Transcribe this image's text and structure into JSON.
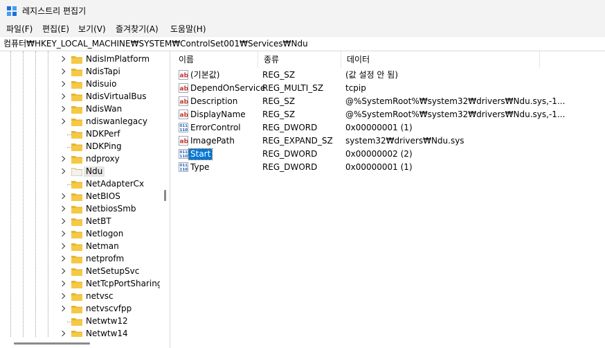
{
  "window": {
    "title": "레지스트리 편집기"
  },
  "menu": [
    "파일(F)",
    "편집(E)",
    "보기(V)",
    "즐겨찾기(A)",
    "도움말(H)"
  ],
  "address": "컴퓨터₩HKEY_LOCAL_MACHINE₩SYSTEM₩ControlSet001₩Services₩Ndu",
  "tree": {
    "items": [
      {
        "label": "NdisImPlatform",
        "expandable": true
      },
      {
        "label": "NdisTapi",
        "expandable": true
      },
      {
        "label": "Ndisuio",
        "expandable": true
      },
      {
        "label": "NdisVirtualBus",
        "expandable": true
      },
      {
        "label": "NdisWan",
        "expandable": true
      },
      {
        "label": "ndiswanlegacy",
        "expandable": true
      },
      {
        "label": "NDKPerf",
        "expandable": false
      },
      {
        "label": "NDKPing",
        "expandable": false
      },
      {
        "label": "ndproxy",
        "expandable": true
      },
      {
        "label": "Ndu",
        "expandable": true,
        "selected": true
      },
      {
        "label": "NetAdapterCx",
        "expandable": false
      },
      {
        "label": "NetBIOS",
        "expandable": true
      },
      {
        "label": "NetbiosSmb",
        "expandable": true
      },
      {
        "label": "NetBT",
        "expandable": true
      },
      {
        "label": "Netlogon",
        "expandable": true
      },
      {
        "label": "Netman",
        "expandable": true
      },
      {
        "label": "netprofm",
        "expandable": true
      },
      {
        "label": "NetSetupSvc",
        "expandable": true
      },
      {
        "label": "NetTcpPortSharing",
        "expandable": true
      },
      {
        "label": "netvsc",
        "expandable": true
      },
      {
        "label": "netvscvfpp",
        "expandable": true
      },
      {
        "label": "Netwtw12",
        "expandable": false
      },
      {
        "label": "Netwtw14",
        "expandable": true
      }
    ]
  },
  "list": {
    "columns": [
      "이름",
      "종류",
      "데이터"
    ],
    "rows": [
      {
        "name": "(기본값)",
        "type": "REG_SZ",
        "data": "(값 설정 안 됨)",
        "icon": "string-value-icon"
      },
      {
        "name": "DependOnService",
        "type": "REG_MULTI_SZ",
        "data": "tcpip",
        "icon": "string-value-icon"
      },
      {
        "name": "Description",
        "type": "REG_SZ",
        "data": "@%SystemRoot%₩system32₩drivers₩Ndu.sys,-1...",
        "icon": "string-value-icon"
      },
      {
        "name": "DisplayName",
        "type": "REG_SZ",
        "data": "@%SystemRoot%₩system32₩drivers₩Ndu.sys,-1...",
        "icon": "string-value-icon"
      },
      {
        "name": "ErrorControl",
        "type": "REG_DWORD",
        "data": "0x00000001 (1)",
        "icon": "binary-value-icon"
      },
      {
        "name": "ImagePath",
        "type": "REG_EXPAND_SZ",
        "data": "system32₩drivers₩Ndu.sys",
        "icon": "string-value-icon"
      },
      {
        "name": "Start",
        "type": "REG_DWORD",
        "data": "0x00000002 (2)",
        "icon": "binary-value-icon",
        "selected": true
      },
      {
        "name": "Type",
        "type": "REG_DWORD",
        "data": "0x00000001 (1)",
        "icon": "binary-value-icon"
      }
    ]
  },
  "colors": {
    "selection": "#0078d7",
    "folder": "#f5c945",
    "string_icon": "#c0392b",
    "binary_icon": "#1f5fb5"
  }
}
